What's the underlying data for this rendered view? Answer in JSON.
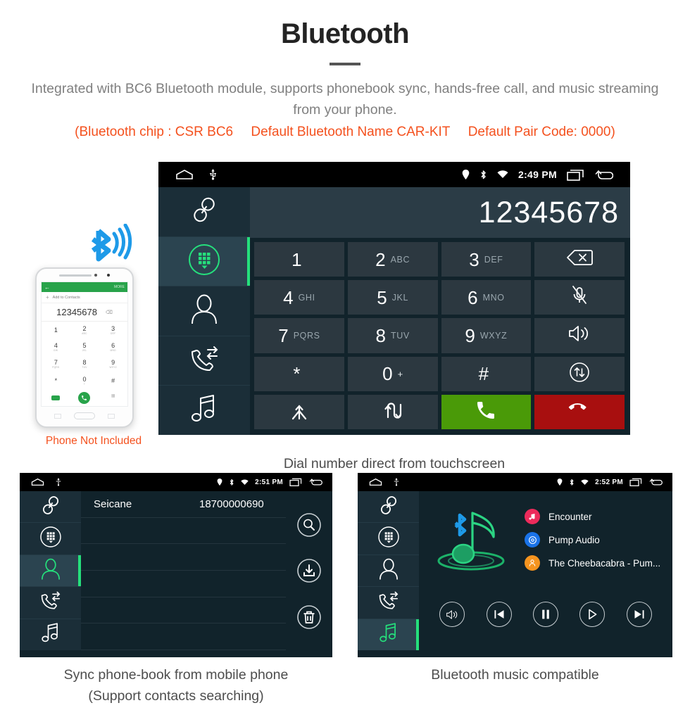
{
  "header": {
    "title": "Bluetooth",
    "subtitle": "Integrated with BC6 Bluetooth module, supports phonebook sync, hands-free call, and music streaming from your phone.",
    "note_chip": "(Bluetooth chip : CSR BC6",
    "note_name": "Default Bluetooth Name CAR-KIT",
    "note_pair": "Default Pair Code: 0000)",
    "accent_red": "#f4511e",
    "subtitle_color": "#808080"
  },
  "phone_illustration": {
    "caption": "Phone Not Included",
    "bluetooth_icon": "bluetooth-signal-icon",
    "screen": {
      "more_label": "MORE",
      "add_contact_label": "Add to Contacts",
      "number": "12345678",
      "keys": [
        {
          "digit": "1",
          "letters": ""
        },
        {
          "digit": "2",
          "letters": "ABC"
        },
        {
          "digit": "3",
          "letters": "DEF"
        },
        {
          "digit": "4",
          "letters": "GHI"
        },
        {
          "digit": "5",
          "letters": "JKL"
        },
        {
          "digit": "6",
          "letters": "MNO"
        },
        {
          "digit": "7",
          "letters": "PQRS"
        },
        {
          "digit": "8",
          "letters": "TUV"
        },
        {
          "digit": "9",
          "letters": "WXYZ"
        },
        {
          "digit": "*",
          "letters": ""
        },
        {
          "digit": "0",
          "letters": "+"
        },
        {
          "digit": "#",
          "letters": ""
        }
      ]
    }
  },
  "main_unit": {
    "statusbar": {
      "home_icon": "home-icon",
      "usb_icon": "usb-icon",
      "location_icon": "location-pin-icon",
      "bluetooth_icon": "bluetooth-icon",
      "wifi_icon": "wifi-icon",
      "time": "2:49 PM",
      "recents_icon": "recents-icon",
      "back_icon": "back-arrow-icon"
    },
    "rail": [
      {
        "name": "pair-link",
        "icon": "link-icon",
        "active": false
      },
      {
        "name": "dialpad",
        "icon": "dialpad-icon",
        "active": true
      },
      {
        "name": "contacts",
        "icon": "contact-person-icon",
        "active": false
      },
      {
        "name": "call-history",
        "icon": "call-history-icon",
        "active": false
      },
      {
        "name": "music",
        "icon": "music-note-icon",
        "active": false
      }
    ],
    "dialed_number": "12345678",
    "keypad": [
      {
        "digit": "1",
        "letters": "",
        "kind": "digit"
      },
      {
        "digit": "2",
        "letters": "ABC",
        "kind": "digit"
      },
      {
        "digit": "3",
        "letters": "DEF",
        "kind": "digit"
      },
      {
        "icon": "backspace-icon",
        "kind": "func",
        "name": "backspace-key"
      },
      {
        "digit": "4",
        "letters": "GHI",
        "kind": "digit"
      },
      {
        "digit": "5",
        "letters": "JKL",
        "kind": "digit"
      },
      {
        "digit": "6",
        "letters": "MNO",
        "kind": "digit"
      },
      {
        "icon": "mic-mute-icon",
        "kind": "func",
        "name": "mute-key"
      },
      {
        "digit": "7",
        "letters": "PQRS",
        "kind": "digit"
      },
      {
        "digit": "8",
        "letters": "TUV",
        "kind": "digit"
      },
      {
        "digit": "9",
        "letters": "WXYZ",
        "kind": "digit"
      },
      {
        "icon": "speaker-icon",
        "kind": "func",
        "name": "speaker-key"
      },
      {
        "digit": "*",
        "letters": "",
        "kind": "digit"
      },
      {
        "digit": "0",
        "letters": "+",
        "kind": "digit"
      },
      {
        "digit": "#",
        "letters": "",
        "kind": "digit"
      },
      {
        "icon": "transfer-audio-icon",
        "kind": "func",
        "name": "transfer-key"
      },
      {
        "icon": "merge-call-icon",
        "kind": "func",
        "name": "merge-call-key"
      },
      {
        "icon": "swap-call-icon",
        "kind": "func",
        "name": "swap-call-key"
      },
      {
        "icon": "call-icon",
        "kind": "green",
        "name": "call-key"
      },
      {
        "icon": "end-call-icon",
        "kind": "red",
        "name": "end-call-key"
      }
    ],
    "caption": "Dial number direct from touchscreen",
    "colors": {
      "call_green": "#4a9a08",
      "end_red": "#a80f0f",
      "active_green": "#25e07c"
    }
  },
  "contacts_panel": {
    "statusbar": {
      "time": "2:51 PM"
    },
    "rail": [
      {
        "name": "pair-link",
        "icon": "link-icon",
        "active": false
      },
      {
        "name": "dialpad",
        "icon": "dialpad-icon",
        "active": false
      },
      {
        "name": "contacts",
        "icon": "contact-person-icon",
        "active": true
      },
      {
        "name": "call-history",
        "icon": "call-history-icon",
        "active": false
      },
      {
        "name": "music",
        "icon": "music-note-icon",
        "active": false
      }
    ],
    "rows": [
      {
        "name": "Seicane",
        "number": "18700000690"
      },
      {
        "name": "",
        "number": ""
      },
      {
        "name": "",
        "number": ""
      },
      {
        "name": "",
        "number": ""
      },
      {
        "name": "",
        "number": ""
      },
      {
        "name": "",
        "number": ""
      }
    ],
    "actions": [
      {
        "name": "search-contacts",
        "icon": "search-icon"
      },
      {
        "name": "download-contacts",
        "icon": "download-icon"
      },
      {
        "name": "delete-contacts",
        "icon": "trash-icon"
      }
    ],
    "caption_line1": "Sync phone-book from mobile phone",
    "caption_line2": "(Support contacts searching)"
  },
  "music_panel": {
    "statusbar": {
      "time": "2:52 PM"
    },
    "rail": [
      {
        "name": "pair-link",
        "icon": "link-icon",
        "active": false
      },
      {
        "name": "dialpad",
        "icon": "dialpad-icon",
        "active": false
      },
      {
        "name": "contacts",
        "icon": "contact-person-icon",
        "active": false
      },
      {
        "name": "call-history",
        "icon": "call-history-icon",
        "active": false
      },
      {
        "name": "music",
        "icon": "music-note-icon",
        "active": true
      }
    ],
    "artwork_icon": "bluetooth-music-note-icon",
    "tracks": [
      {
        "label": "Encounter",
        "icon": "music-note-badge-icon",
        "color": "#ec2b5b"
      },
      {
        "label": "Pump Audio",
        "icon": "disc-badge-icon",
        "color": "#1a73e8"
      },
      {
        "label": "The Cheebacabra - Pum...",
        "icon": "artist-badge-icon",
        "color": "#f5941f"
      }
    ],
    "controls": [
      {
        "name": "volume-button",
        "icon": "speaker-icon"
      },
      {
        "name": "previous-button",
        "icon": "skip-back-icon"
      },
      {
        "name": "pause-button",
        "icon": "pause-icon"
      },
      {
        "name": "play-button",
        "icon": "play-icon"
      },
      {
        "name": "next-button",
        "icon": "skip-forward-icon"
      }
    ],
    "caption": "Bluetooth music compatible"
  }
}
